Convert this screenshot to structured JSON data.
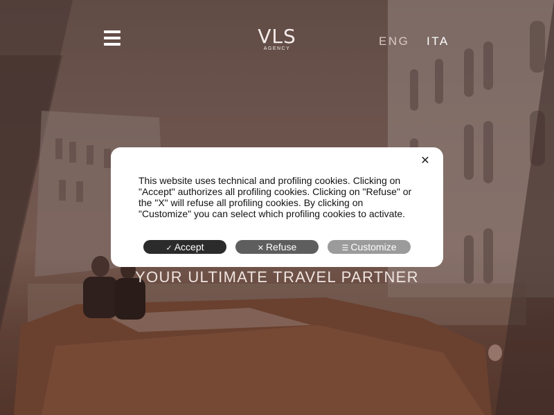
{
  "header": {
    "menu_icon": "hamburger-menu-icon",
    "logo": {
      "main": "VLS",
      "sub": "AGENCY"
    },
    "languages": [
      "ENG",
      "ITA"
    ]
  },
  "hero": {
    "tagline": "YOUR ULTIMATE TRAVEL PARTNER"
  },
  "cookie_banner": {
    "text": "This website uses technical and profiling cookies. Clicking on \"Accept\" authorizes all profiling cookies. Clicking on \"Refuse\" or the \"X\" will refuse all profiling cookies. By clicking on \"Customize\" you can select which profiling cookies to activate.",
    "close_glyph": "✕",
    "buttons": {
      "accept": {
        "label": "Accept",
        "icon": "check-icon",
        "glyph": "✓"
      },
      "refuse": {
        "label": "Refuse",
        "icon": "x-icon",
        "glyph": "✕"
      },
      "customize": {
        "label": "Customize",
        "icon": "list-icon",
        "glyph": "☰"
      }
    },
    "colors": {
      "accept": "#2b2b2b",
      "refuse": "#5e5e5e",
      "customize": "#9b9b9b"
    }
  }
}
